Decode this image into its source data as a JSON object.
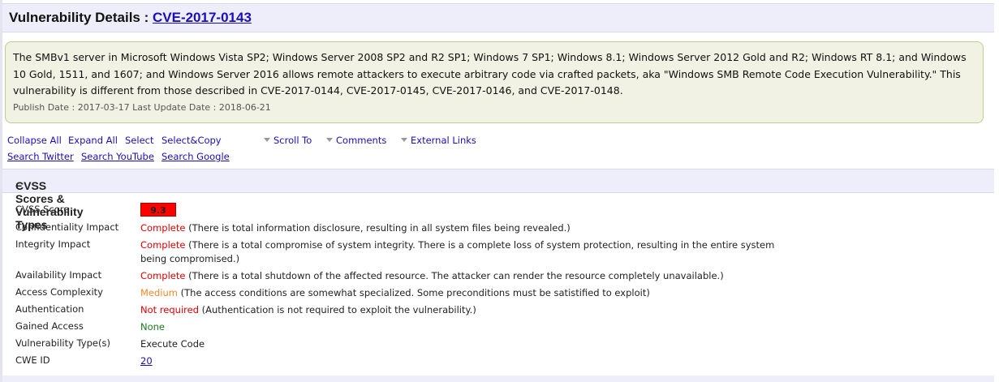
{
  "header": {
    "prefix": "Vulnerability Details : ",
    "cve_id": "CVE-2017-0143"
  },
  "summary": {
    "description": "The SMBv1 server in Microsoft Windows Vista SP2; Windows Server 2008 SP2 and R2 SP1; Windows 7 SP1; Windows 8.1; Windows Server 2012 Gold and R2; Windows RT 8.1; and Windows 10 Gold, 1511, and 1607; and Windows Server 2016 allows remote attackers to execute arbitrary code via crafted packets, aka \"Windows SMB Remote Code Execution Vulnerability.\" This vulnerability is different from those described in CVE-2017-0144, CVE-2017-0145, CVE-2017-0146, and CVE-2017-0148.",
    "dates": "Publish Date : 2017-03-17 Last Update Date : 2018-06-21"
  },
  "actions": {
    "collapse_all": "Collapse All",
    "expand_all": "Expand All",
    "select": "Select",
    "select_copy": "Select&Copy",
    "scroll_to": "Scroll To",
    "comments": "Comments",
    "external_links": "External Links",
    "search_twitter": "Search Twitter",
    "search_youtube": "Search YouTube",
    "search_google": "Search Google"
  },
  "section": {
    "title": "CVSS Scores & Vulnerability Types",
    "toggle": "−"
  },
  "cvss": {
    "score_label": "CVSS Score",
    "score": "9.3",
    "confidentiality_label": "Confidentiality Impact",
    "confidentiality_value": "Complete",
    "confidentiality_note": " (There is total information disclosure, resulting in all system files being revealed.)",
    "integrity_label": "Integrity Impact",
    "integrity_value": "Complete",
    "integrity_note": " (There is a total compromise of system integrity. There is a complete loss of system protection, resulting in the entire system being compromised.)",
    "availability_label": "Availability Impact",
    "availability_value": "Complete",
    "availability_note": " (There is a total shutdown of the affected resource. The attacker can render the resource completely unavailable.)",
    "complexity_label": "Access Complexity",
    "complexity_value": "Medium",
    "complexity_note": " (The access conditions are somewhat specialized. Some preconditions must be satistified to exploit)",
    "authentication_label": "Authentication",
    "authentication_value": "Not required",
    "authentication_note": " (Authentication is not required to exploit the vulnerability.)",
    "gained_access_label": "Gained Access",
    "gained_access_value": "None",
    "vuln_types_label": "Vulnerability Type(s)",
    "vuln_types_value": "Execute Code",
    "cwe_label": "CWE ID",
    "cwe_value": "20"
  },
  "colors": {
    "link": "#1a0dbb",
    "severity_red": "#ff0000",
    "complete_red": "#e00000",
    "medium_orange": "#ee8a2a",
    "none_green": "#1a7a1a",
    "header_bg": "#eeeefa",
    "summary_bg": "#f1f2e3",
    "summary_border": "#b8d08a"
  }
}
